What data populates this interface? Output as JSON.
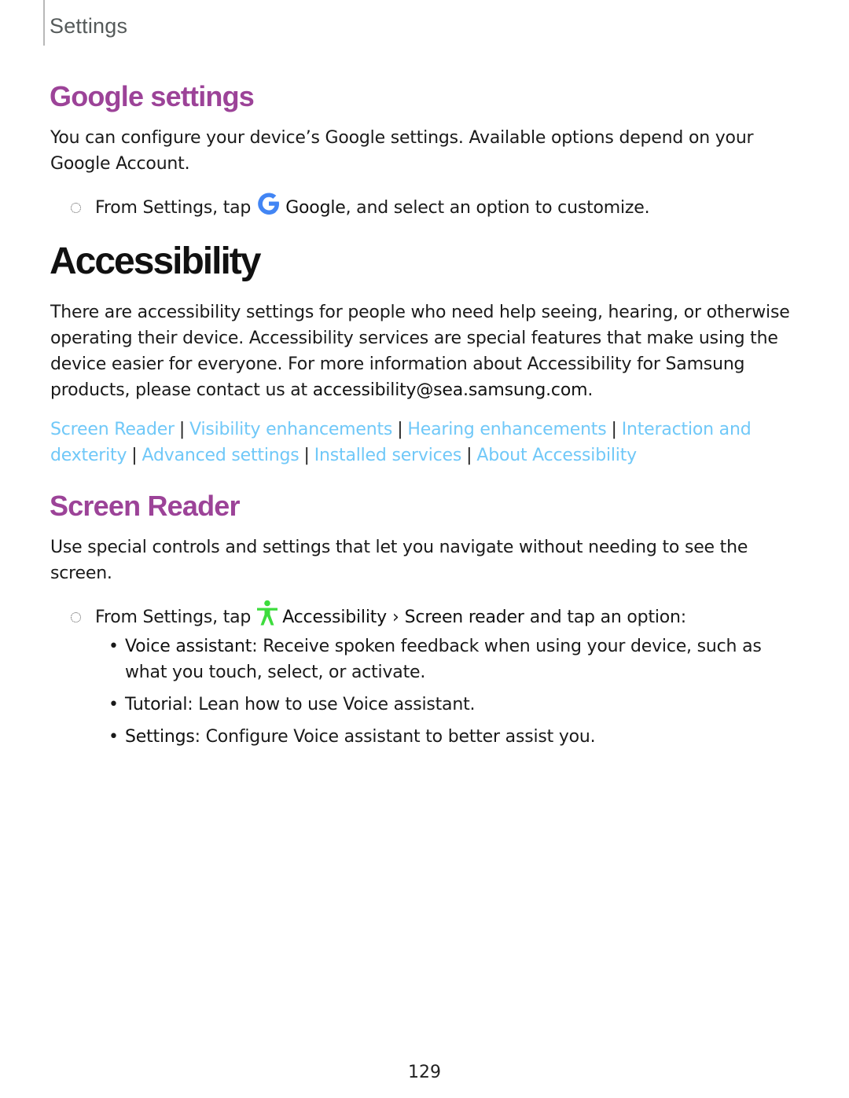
{
  "header": {
    "section_label": "Settings"
  },
  "google_settings": {
    "title": "Google settings",
    "description": "You can configure your device’s Google settings. Available options depend on your Google Account.",
    "step": {
      "prefix": "From Settings, tap",
      "icon": "google-g-icon",
      "target": "Google",
      "suffix": ", and select an option to customize."
    }
  },
  "accessibility": {
    "title": "Accessibility",
    "description_prefix": "There are accessibility settings for people who need help seeing, hearing, or otherwise operating their device. Accessibility services are special features that make using the device easier for everyone. For more information about Accessibility for Samsung products, please contact us at ",
    "email": "accessibility@sea.samsung.com",
    "description_suffix": ".",
    "links": [
      {
        "label": "Screen Reader"
      },
      {
        "label": "Visibility enhancements"
      },
      {
        "label": "Hearing enhancements"
      },
      {
        "label": "Interaction and dexterity"
      },
      {
        "label": "Advanced settings"
      },
      {
        "label": "Installed services"
      },
      {
        "label": "About Accessibility"
      }
    ],
    "link_separator": "|"
  },
  "screen_reader": {
    "title": "Screen Reader",
    "description": "Use special controls and settings that let you navigate without needing to see the screen.",
    "step": {
      "prefix": "From Settings, tap",
      "icon": "accessibility-person-icon",
      "target1": "Accessibility",
      "chevron": "›",
      "target2": "Screen reader",
      "suffix": "and tap an option:"
    },
    "options": [
      {
        "term": "Voice assistant",
        "text": ": Receive spoken feedback when using your device, such as what you touch, select, or activate."
      },
      {
        "term": "Tutorial",
        "text": ": Lean how to use Voice assistant."
      },
      {
        "term": "Settings",
        "text": ": Configure Voice assistant to better assist you."
      }
    ],
    "bullet": "•"
  },
  "footer": {
    "page_number": "129"
  },
  "colors": {
    "heading_purple": "#9c4398",
    "link_blue": "#70c8f8",
    "google_blue": "#4285f4",
    "accessibility_green": "#3ddc3d"
  }
}
